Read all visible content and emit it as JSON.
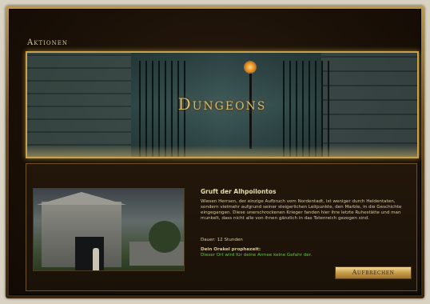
{
  "window": {
    "title": "Aktionen"
  },
  "banner": {
    "title": "Dungeons"
  },
  "quest": {
    "title": "Gruft der Alhpoilontos",
    "description": "Wiesen Herrsen, der einzige Aufbruch vom Nordentadt, ist weniger durch Heldentaten, sondern vielmehr aufgrund seiner steigerlichen Leitpunkte, den Marble, in die Geschichte eingegangen. Diese unerschrockenen Krieger fanden hier ihre letzte Ruhestätte und man munkelt, dass nicht alle von ihnen gänzlich in das Totenreich gezogen sind.",
    "duration": "Dauer: 12 Stunden",
    "oracle_title": "Dein Orakel prophezeit:",
    "oracle_text": "Dieser Ort wird für deine Armee keine Gefahr der."
  },
  "actions": {
    "start_label": "Aufbrechen"
  },
  "colors": {
    "accent_gold": "#c9a24a",
    "oracle_green": "#5ccc3c",
    "background": "#1a1007"
  }
}
